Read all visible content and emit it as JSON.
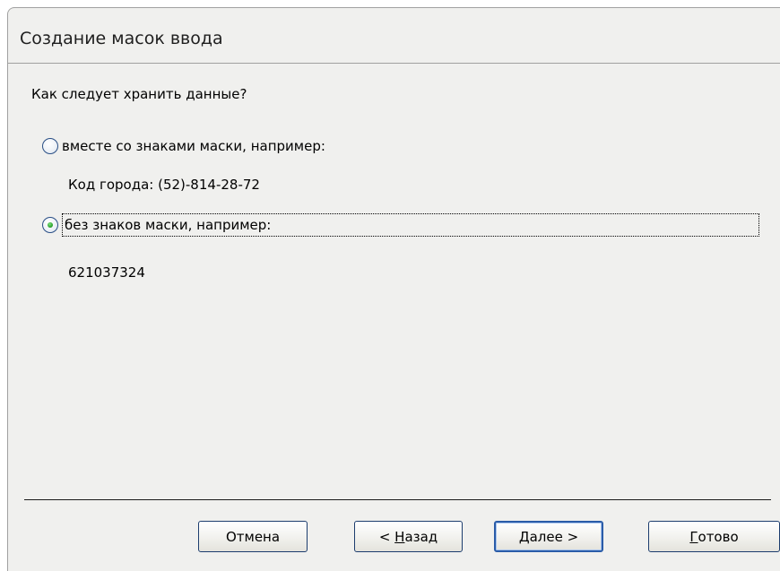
{
  "window": {
    "title": "Создание масок ввода"
  },
  "question": "Как следует хранить данные?",
  "options": [
    {
      "label": "вместе со знаками маски, например:",
      "example": "Код города: (52)-814-28-72",
      "selected": false
    },
    {
      "label": "без знаков маски, например:",
      "example": "621037324",
      "selected": true
    }
  ],
  "buttons": {
    "cancel": "Отмена",
    "back_prefix": "< ",
    "back_accel": "Н",
    "back_rest": "азад",
    "next_accel": "Д",
    "next_rest": "алее >",
    "finish_accel": "Г",
    "finish_rest": "отово"
  },
  "colors": {
    "dialog_background": "#f0f0ee",
    "radio_dot": "#2ea52e",
    "default_button_border": "#2a5ca8"
  }
}
